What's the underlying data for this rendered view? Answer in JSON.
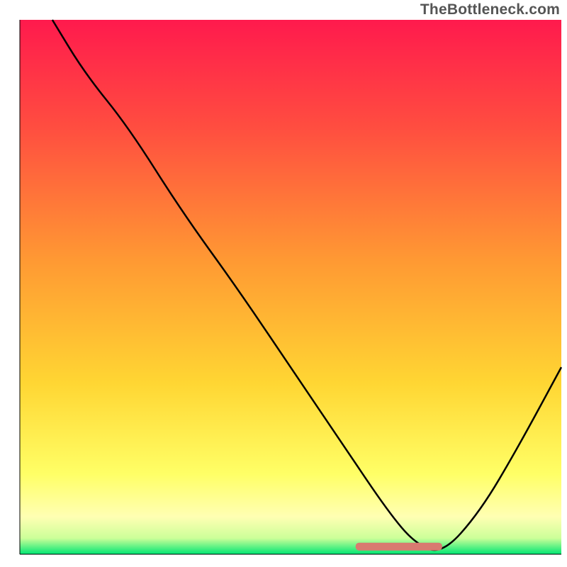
{
  "watermark": "TheBottleneck.com",
  "chart_data": {
    "type": "line",
    "title": "",
    "xlabel": "",
    "ylabel": "",
    "xlim": [
      0,
      100
    ],
    "ylim": [
      0,
      100
    ],
    "background": {
      "type": "vertical_gradient",
      "stops": [
        {
          "pos": 0.0,
          "color": "#ff1a4d"
        },
        {
          "pos": 0.2,
          "color": "#ff4d40"
        },
        {
          "pos": 0.45,
          "color": "#ff9933"
        },
        {
          "pos": 0.68,
          "color": "#ffd633"
        },
        {
          "pos": 0.85,
          "color": "#ffff66"
        },
        {
          "pos": 0.93,
          "color": "#ffffb3"
        },
        {
          "pos": 0.97,
          "color": "#ccff99"
        },
        {
          "pos": 1.0,
          "color": "#00e673"
        }
      ]
    },
    "curve": {
      "x": [
        6,
        12,
        20,
        30,
        40,
        50,
        60,
        68,
        73,
        78,
        85,
        92,
        100
      ],
      "y": [
        100,
        90,
        80,
        64,
        50,
        35,
        20,
        8,
        2,
        0,
        8,
        20,
        35
      ]
    },
    "marker_band": {
      "xmin": 62,
      "xmax": 78,
      "y": 1.5,
      "color": "#d97a70"
    }
  }
}
